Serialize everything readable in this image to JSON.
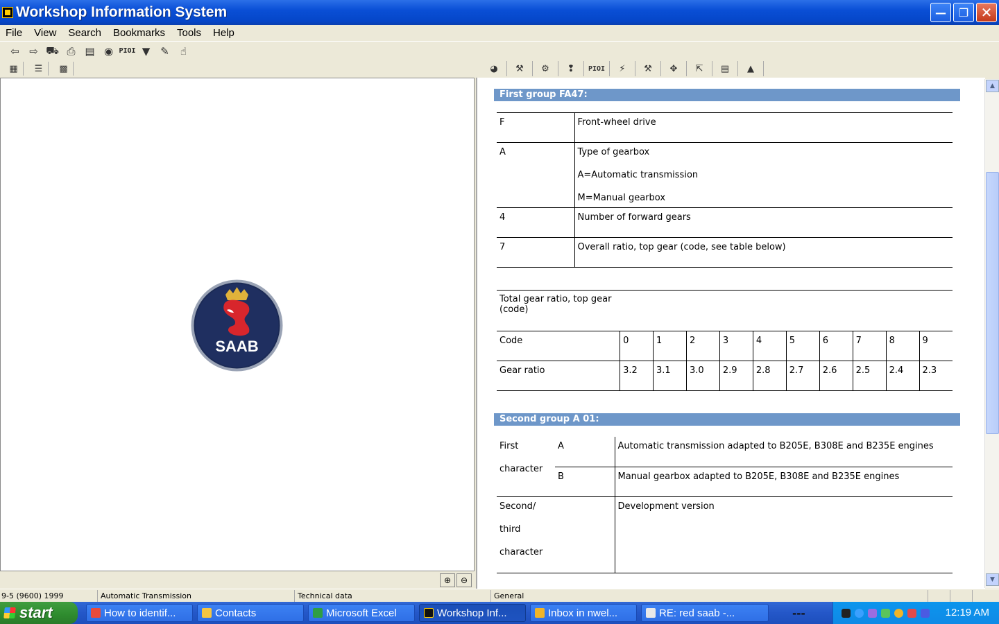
{
  "window": {
    "title": "Workshop Information System"
  },
  "menu": [
    "File",
    "View",
    "Search",
    "Bookmarks",
    "Tools",
    "Help"
  ],
  "toolbar": {
    "pio_label": "PIOI"
  },
  "right_tabs": {
    "pio_label": "PIOI"
  },
  "logo": {
    "text": "SAAB"
  },
  "first_group": {
    "header": "First group FA47:",
    "rows": [
      {
        "key": "F",
        "lines": [
          "Front-wheel drive"
        ]
      },
      {
        "key": "A",
        "lines": [
          "Type of gearbox",
          "A=Automatic transmission",
          "M=Manual gearbox"
        ]
      },
      {
        "key": "4",
        "lines": [
          "Number of forward gears"
        ]
      },
      {
        "key": "7",
        "lines": [
          "Overall ratio, top gear (code, see table below)"
        ]
      }
    ]
  },
  "gear_table": {
    "title": "Total gear ratio, top gear (code)",
    "code_label": "Code",
    "codes": [
      "0",
      "1",
      "2",
      "3",
      "4",
      "5",
      "6",
      "7",
      "8",
      "9"
    ],
    "ratio_label": "Gear ratio",
    "ratios": [
      "3.2",
      "3.1",
      "3.0",
      "2.9",
      "2.8",
      "2.7",
      "2.6",
      "2.5",
      "2.4",
      "2.3"
    ]
  },
  "second_group": {
    "header": "Second group A 01:",
    "first_char_label_1": "First",
    "first_char_label_2": "character",
    "first_char_rows": [
      {
        "code": "A",
        "desc": "Automatic transmission adapted to B205E, B308E and B235E engines"
      },
      {
        "code": "B",
        "desc": "Manual gearbox adapted to B205E, B308E and B235E engines"
      }
    ],
    "second_char_lines": [
      "Second/",
      "third",
      "character"
    ],
    "second_char_desc": "Development version"
  },
  "status": {
    "model": "9-5 (9600) 1999",
    "section": "Automatic Transmission",
    "category": "Technical data",
    "info": "General"
  },
  "taskbar": {
    "start": "start",
    "tasks": [
      {
        "label": "How to identif...",
        "color": "#e94b3c"
      },
      {
        "label": "Contacts",
        "color": "#f5c542"
      },
      {
        "label": "Microsoft Excel",
        "color": "#2f9e44"
      },
      {
        "label": "Workshop Inf...",
        "color": "#111111"
      },
      {
        "label": "Inbox in nwel...",
        "color": "#f0b429"
      },
      {
        "label": "RE: red saab -...",
        "color": "#e8e8e8"
      }
    ],
    "tray_dash": "---",
    "clock": "12:19 AM"
  }
}
